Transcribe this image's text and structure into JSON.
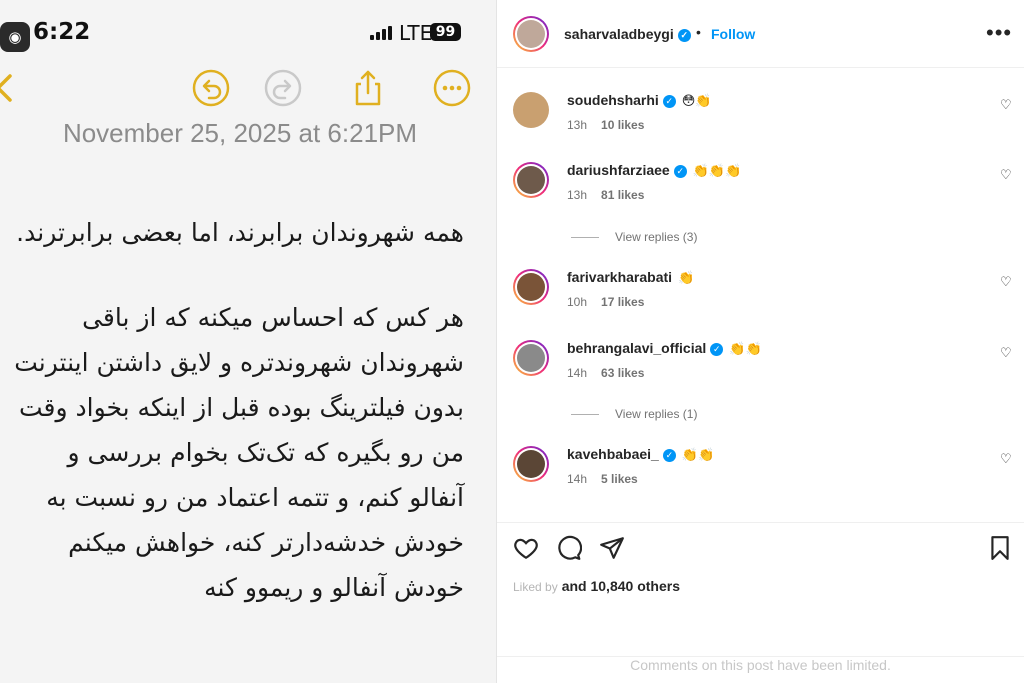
{
  "status_bar": {
    "time": "6:22",
    "network": "LTE",
    "battery": "99"
  },
  "note": {
    "date": "November 25, 2025 at 6:21PM",
    "paragraph1": "همه شهروندان برابرند، اما بعضی برابرترند.",
    "paragraph2": "هر کس که احساس میکنه که از باقی شهروندان شهروندتره و لایق داشتن اینترنت بدون فیلترینگ بوده قبل از اینکه بخواد وقت من رو بگیره که تک‌تک بخوام بررسی و آنفالو کنم، و تتمه اعتماد من رو نسبت به خودش خدشه‌دارتر کنه، خواهش میکنم خودش آنفالو و ریموو کنه"
  },
  "post": {
    "author": "saharvaladbeygi",
    "separator": "•",
    "follow_label": "Follow",
    "more_label": "•••",
    "comments": [
      {
        "user": "soudehsharhi",
        "emoji": "😳👏",
        "time": "13h",
        "likes": "10 likes"
      },
      {
        "user": "dariushfarziaee",
        "emoji": "👏👏👏",
        "time": "13h",
        "likes": "81 likes",
        "replies": "View replies (3)"
      },
      {
        "user": "farivarkharabati",
        "emoji": "👏",
        "time": "10h",
        "likes": "17 likes"
      },
      {
        "user": "behrangalavi_official",
        "emoji": "👏👏",
        "time": "14h",
        "likes": "63 likes",
        "replies": "View replies (1)"
      },
      {
        "user": "kavehbabaei_",
        "emoji": "👏👏",
        "time": "14h",
        "likes": "5 likes"
      }
    ],
    "liked_by_prefix": "Liked by",
    "liked_by_others": "and 10,840 others",
    "comments_limited": "Comments on this post have been limited."
  },
  "colors": {
    "accent_yellow": "#e0b020",
    "ig_blue": "#0095f6"
  }
}
